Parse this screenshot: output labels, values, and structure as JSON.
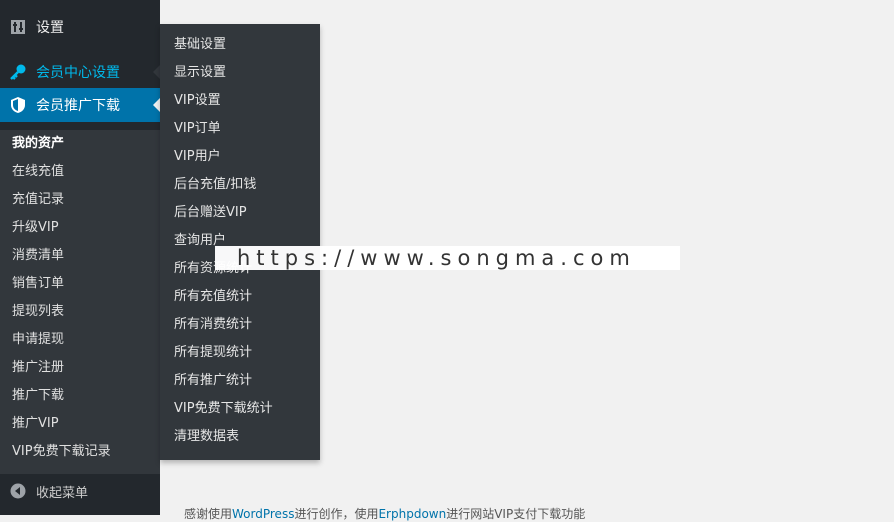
{
  "sidebar": {
    "settings_label": "设置",
    "member_center_label": "会员中心设置",
    "promo_download_label": "会员推广下载",
    "submenu": [
      "我的资产",
      "在线充值",
      "充值记录",
      "升级VIP",
      "消费清单",
      "销售订单",
      "提现列表",
      "申请提现",
      "推广注册",
      "推广下载",
      "推广VIP",
      "VIP免费下载记录"
    ],
    "collapse_label": "收起菜单"
  },
  "flyout": {
    "items": [
      "基础设置",
      "显示设置",
      "VIP设置",
      "VIP订单",
      "VIP用户",
      "后台充值/扣钱",
      "后台赠送VIP",
      "查询用户",
      "所有资源统计",
      "所有充值统计",
      "所有消费统计",
      "所有提现统计",
      "所有推广统计",
      "VIP免费下载统计",
      "清理数据表"
    ]
  },
  "watermark": "https://www.songma.com",
  "footer": {
    "text_1": "感谢使用",
    "link_1": "WordPress",
    "text_2": "进行创作，使用",
    "link_2": "Erphpdown",
    "text_3": "进行网站VIP支付下载功能"
  },
  "colors": {
    "sidebar_bg": "#23282d",
    "submenu_bg": "#32373c",
    "accent": "#0073aa",
    "highlight": "#00b9eb"
  }
}
